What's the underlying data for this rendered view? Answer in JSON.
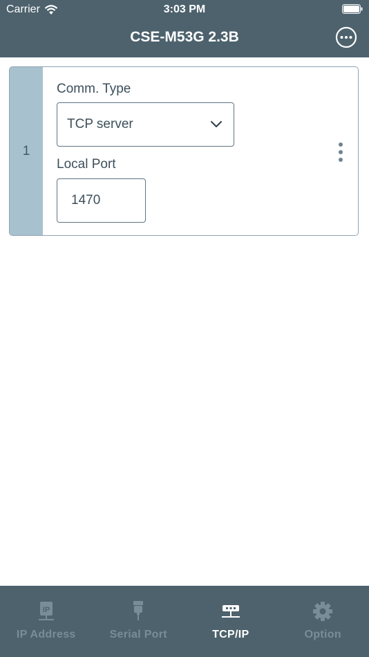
{
  "status_bar": {
    "carrier": "Carrier",
    "time": "3:03 PM"
  },
  "header": {
    "title": "CSE-M53G 2.3B",
    "more_icon": "more-circle-icon"
  },
  "card": {
    "index": "1",
    "comm_type_label": "Comm. Type",
    "comm_type_value": "TCP server",
    "local_port_label": "Local Port",
    "local_port_value": "1470"
  },
  "tabs": [
    {
      "label": "IP Address",
      "icon": "ip-icon",
      "active": false
    },
    {
      "label": "Serial Port",
      "icon": "serial-port-icon",
      "active": false
    },
    {
      "label": "TCP/IP",
      "icon": "network-icon",
      "active": true
    },
    {
      "label": "Option",
      "icon": "gear-icon",
      "active": false
    }
  ],
  "colors": {
    "header_bg": "#4d626d",
    "index_bg": "#a8c1cf",
    "tab_active": "#ffffff",
    "tab_inactive": "#7a8d97"
  }
}
